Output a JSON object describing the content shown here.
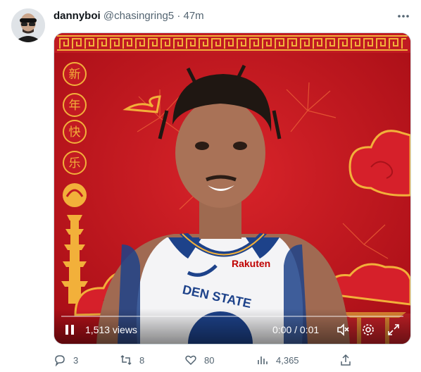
{
  "tweet": {
    "display_name": "dannyboi",
    "handle": "@chasingring5",
    "separator": "·",
    "time": "47m"
  },
  "media": {
    "overlay_text": [
      "新",
      "年",
      "快",
      "乐"
    ],
    "jersey_sponsor": "Rakuten",
    "jersey_text": "DEN STATE",
    "video": {
      "views": "1,513 views",
      "timecode": "0:00 / 0:01",
      "progress": 0,
      "state": "playing",
      "muted": true
    }
  },
  "actions": {
    "reply_count": "3",
    "retweet_count": "8",
    "like_count": "80",
    "view_count": "4,365"
  },
  "icons": [
    "more-icon",
    "pause-icon",
    "mute-icon",
    "settings-icon",
    "fullscreen-icon",
    "reply-icon",
    "retweet-icon",
    "like-icon",
    "views-icon",
    "share-icon"
  ],
  "colors": {
    "background": "#c4141e",
    "accent": "#f2b03a",
    "text_secondary": "#536471"
  }
}
